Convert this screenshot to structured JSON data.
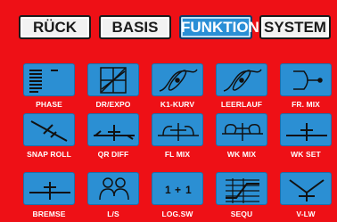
{
  "tabs": [
    {
      "label": "RÜCK",
      "active": false
    },
    {
      "label": "BASIS",
      "active": false
    },
    {
      "label": "FUNKTION",
      "active": true
    },
    {
      "label": "SYSTEM",
      "active": false
    }
  ],
  "functions": [
    {
      "label": "PHASE",
      "icon": "phase-icon"
    },
    {
      "label": "DR/EXPO",
      "icon": "dr-expo-icon"
    },
    {
      "label": "K1-KURV",
      "icon": "k1-curve-icon"
    },
    {
      "label": "LEERLAUF",
      "icon": "idle-icon"
    },
    {
      "label": "FR. MIX",
      "icon": "free-mix-icon"
    },
    {
      "label": "SNAP ROLL",
      "icon": "snap-roll-icon"
    },
    {
      "label": "QR DIFF",
      "icon": "aileron-diff-icon"
    },
    {
      "label": "FL MIX",
      "icon": "flap-mix-icon"
    },
    {
      "label": "WK MIX",
      "icon": "wing-mix-icon"
    },
    {
      "label": "WK SET",
      "icon": "wing-set-icon"
    },
    {
      "label": "BREMSE",
      "icon": "brake-icon"
    },
    {
      "label": "L/S",
      "icon": "trainer-icon"
    },
    {
      "label": "LOG.SW",
      "icon": "logic-switch-icon"
    },
    {
      "label": "SEQU",
      "icon": "sequencer-icon"
    },
    {
      "label": "V-LW",
      "icon": "v-tail-icon"
    }
  ],
  "colors": {
    "background": "#ee1016",
    "tile": "#2b8fd3",
    "active_tab": "#2a8fd6"
  }
}
